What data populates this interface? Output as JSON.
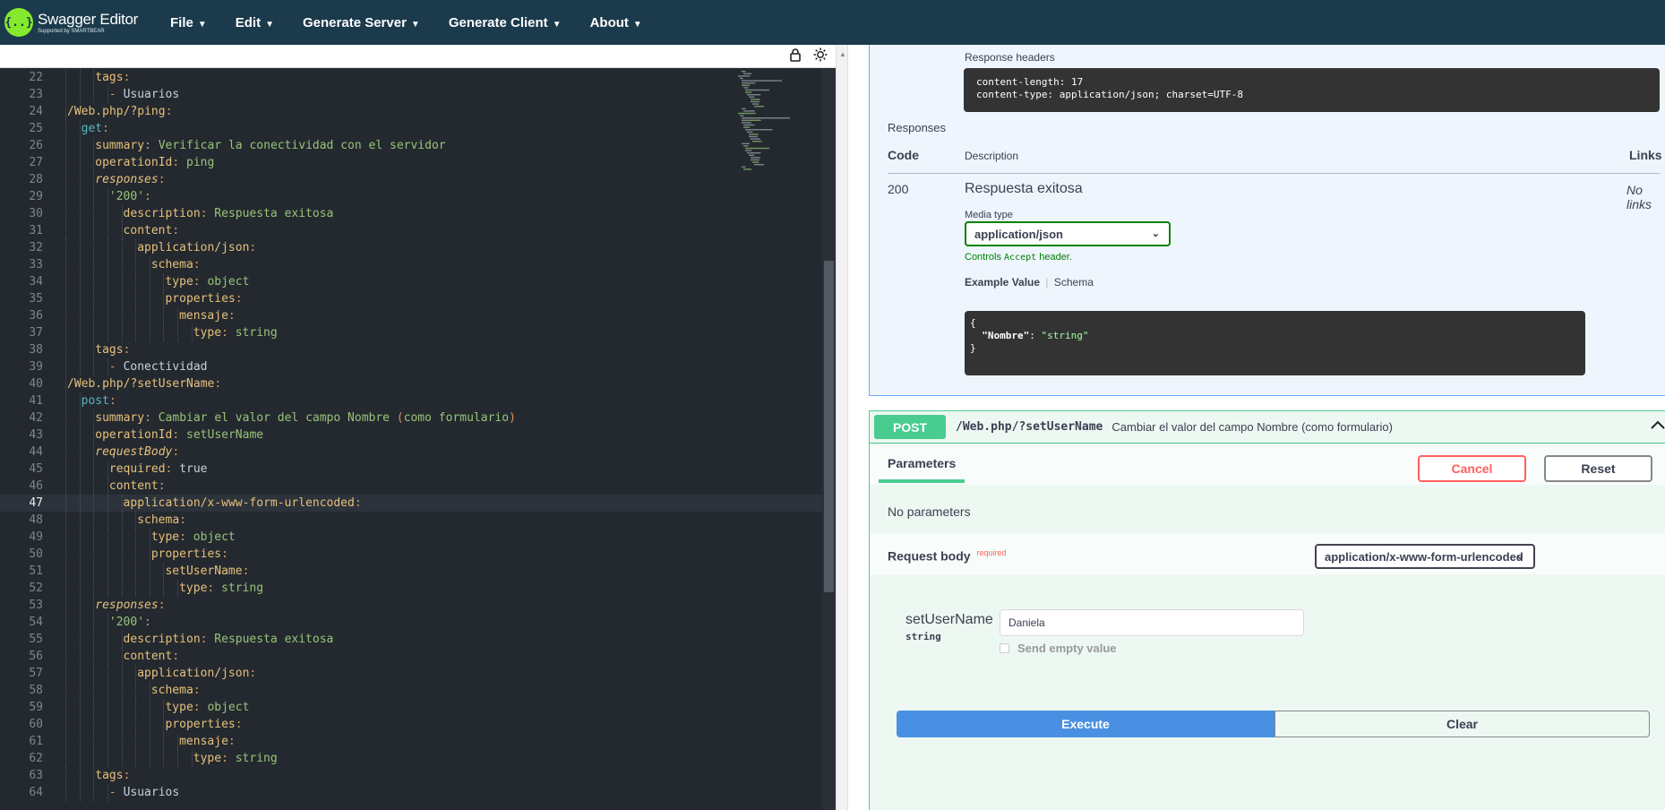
{
  "app": {
    "logo_text": "Swagger Editor",
    "logo_subtext": "Supported by SMARTBEAR",
    "logo_glyph": "{..}"
  },
  "menu": [
    {
      "label": "File"
    },
    {
      "label": "Edit"
    },
    {
      "label": "Generate Server"
    },
    {
      "label": "Generate Client"
    },
    {
      "label": "About"
    }
  ],
  "editor": {
    "active_line": 47,
    "lines": [
      {
        "n": 22,
        "indent": 3,
        "parts": [
          [
            "k-key",
            "tags"
          ],
          [
            "k-colon",
            ":"
          ]
        ]
      },
      {
        "n": 23,
        "indent": 4,
        "parts": [
          [
            "k-colon",
            "- "
          ],
          [
            "k-val",
            "Usuarios"
          ]
        ]
      },
      {
        "n": 24,
        "indent": 1,
        "parts": [
          [
            "k-path",
            "/Web.php/?ping"
          ],
          [
            "k-colon",
            ":"
          ]
        ]
      },
      {
        "n": 25,
        "indent": 2,
        "parts": [
          [
            "k-method",
            "get"
          ],
          [
            "k-colon",
            ":"
          ]
        ]
      },
      {
        "n": 26,
        "indent": 3,
        "parts": [
          [
            "k-key",
            "summary"
          ],
          [
            "k-colon",
            ": "
          ],
          [
            "k-str",
            "Verificar la conectividad con el servidor"
          ]
        ]
      },
      {
        "n": 27,
        "indent": 3,
        "parts": [
          [
            "k-key",
            "operationId"
          ],
          [
            "k-colon",
            ": "
          ],
          [
            "k-str",
            "ping"
          ]
        ]
      },
      {
        "n": 28,
        "indent": 3,
        "parts": [
          [
            "k-key k-it",
            "responses"
          ],
          [
            "k-colon",
            ":"
          ]
        ]
      },
      {
        "n": 29,
        "indent": 4,
        "parts": [
          [
            "k-str",
            "'200'"
          ],
          [
            "k-colon",
            ":"
          ]
        ]
      },
      {
        "n": 30,
        "indent": 5,
        "parts": [
          [
            "k-key",
            "description"
          ],
          [
            "k-colon",
            ": "
          ],
          [
            "k-str",
            "Respuesta exitosa"
          ]
        ]
      },
      {
        "n": 31,
        "indent": 5,
        "parts": [
          [
            "k-key",
            "content"
          ],
          [
            "k-colon",
            ":"
          ]
        ]
      },
      {
        "n": 32,
        "indent": 6,
        "parts": [
          [
            "k-key",
            "application/json"
          ],
          [
            "k-colon",
            ":"
          ]
        ]
      },
      {
        "n": 33,
        "indent": 7,
        "parts": [
          [
            "k-key",
            "schema"
          ],
          [
            "k-colon",
            ":"
          ]
        ]
      },
      {
        "n": 34,
        "indent": 8,
        "parts": [
          [
            "k-key",
            "type"
          ],
          [
            "k-colon",
            ": "
          ],
          [
            "k-str",
            "object"
          ]
        ]
      },
      {
        "n": 35,
        "indent": 8,
        "parts": [
          [
            "k-key",
            "properties"
          ],
          [
            "k-colon",
            ":"
          ]
        ]
      },
      {
        "n": 36,
        "indent": 9,
        "parts": [
          [
            "k-key",
            "mensaje"
          ],
          [
            "k-colon",
            ":"
          ]
        ]
      },
      {
        "n": 37,
        "indent": 10,
        "parts": [
          [
            "k-key",
            "type"
          ],
          [
            "k-colon",
            ": "
          ],
          [
            "k-str",
            "string"
          ]
        ]
      },
      {
        "n": 38,
        "indent": 3,
        "parts": [
          [
            "k-key",
            "tags"
          ],
          [
            "k-colon",
            ":"
          ]
        ]
      },
      {
        "n": 39,
        "indent": 4,
        "parts": [
          [
            "k-colon",
            "- "
          ],
          [
            "k-val",
            "Conectividad"
          ]
        ]
      },
      {
        "n": 40,
        "indent": 1,
        "parts": [
          [
            "k-path",
            "/Web.php/?setUserName"
          ],
          [
            "k-colon",
            ":"
          ]
        ]
      },
      {
        "n": 41,
        "indent": 2,
        "parts": [
          [
            "k-method",
            "post"
          ],
          [
            "k-colon",
            ":"
          ]
        ]
      },
      {
        "n": 42,
        "indent": 3,
        "parts": [
          [
            "k-key",
            "summary"
          ],
          [
            "k-colon",
            ": "
          ],
          [
            "k-str",
            "Cambiar el valor del campo Nombre "
          ],
          [
            "k-colon",
            "("
          ],
          [
            "k-str",
            "como formulario"
          ],
          [
            "k-colon",
            ")"
          ]
        ]
      },
      {
        "n": 43,
        "indent": 3,
        "parts": [
          [
            "k-key",
            "operationId"
          ],
          [
            "k-colon",
            ": "
          ],
          [
            "k-str",
            "setUserName"
          ]
        ]
      },
      {
        "n": 44,
        "indent": 3,
        "parts": [
          [
            "k-key k-it",
            "requestBody"
          ],
          [
            "k-colon",
            ":"
          ]
        ]
      },
      {
        "n": 45,
        "indent": 4,
        "parts": [
          [
            "k-key",
            "required"
          ],
          [
            "k-colon",
            ": "
          ],
          [
            "k-val",
            "true"
          ]
        ]
      },
      {
        "n": 46,
        "indent": 4,
        "parts": [
          [
            "k-key",
            "content"
          ],
          [
            "k-colon",
            ":"
          ]
        ]
      },
      {
        "n": 47,
        "indent": 5,
        "parts": [
          [
            "k-key",
            "application/x-www-form-urlencoded"
          ],
          [
            "k-colon",
            ":"
          ]
        ]
      },
      {
        "n": 48,
        "indent": 6,
        "parts": [
          [
            "k-key",
            "schema"
          ],
          [
            "k-colon",
            ":"
          ]
        ]
      },
      {
        "n": 49,
        "indent": 7,
        "parts": [
          [
            "k-key",
            "type"
          ],
          [
            "k-colon",
            ": "
          ],
          [
            "k-str",
            "object"
          ]
        ]
      },
      {
        "n": 50,
        "indent": 7,
        "parts": [
          [
            "k-key",
            "properties"
          ],
          [
            "k-colon",
            ":"
          ]
        ]
      },
      {
        "n": 51,
        "indent": 8,
        "parts": [
          [
            "k-key",
            "setUserName"
          ],
          [
            "k-colon",
            ":"
          ]
        ]
      },
      {
        "n": 52,
        "indent": 9,
        "parts": [
          [
            "k-key",
            "type"
          ],
          [
            "k-colon",
            ": "
          ],
          [
            "k-str",
            "string"
          ]
        ]
      },
      {
        "n": 53,
        "indent": 3,
        "parts": [
          [
            "k-key k-it",
            "responses"
          ],
          [
            "k-colon",
            ":"
          ]
        ]
      },
      {
        "n": 54,
        "indent": 4,
        "parts": [
          [
            "k-str",
            "'200'"
          ],
          [
            "k-colon",
            ":"
          ]
        ]
      },
      {
        "n": 55,
        "indent": 5,
        "parts": [
          [
            "k-key",
            "description"
          ],
          [
            "k-colon",
            ": "
          ],
          [
            "k-str",
            "Respuesta exitosa"
          ]
        ]
      },
      {
        "n": 56,
        "indent": 5,
        "parts": [
          [
            "k-key",
            "content"
          ],
          [
            "k-colon",
            ":"
          ]
        ]
      },
      {
        "n": 57,
        "indent": 6,
        "parts": [
          [
            "k-key",
            "application/json"
          ],
          [
            "k-colon",
            ":"
          ]
        ]
      },
      {
        "n": 58,
        "indent": 7,
        "parts": [
          [
            "k-key",
            "schema"
          ],
          [
            "k-colon",
            ":"
          ]
        ]
      },
      {
        "n": 59,
        "indent": 8,
        "parts": [
          [
            "k-key",
            "type"
          ],
          [
            "k-colon",
            ": "
          ],
          [
            "k-str",
            "object"
          ]
        ]
      },
      {
        "n": 60,
        "indent": 8,
        "parts": [
          [
            "k-key",
            "properties"
          ],
          [
            "k-colon",
            ":"
          ]
        ]
      },
      {
        "n": 61,
        "indent": 9,
        "parts": [
          [
            "k-key",
            "mensaje"
          ],
          [
            "k-colon",
            ":"
          ]
        ]
      },
      {
        "n": 62,
        "indent": 10,
        "parts": [
          [
            "k-key",
            "type"
          ],
          [
            "k-colon",
            ": "
          ],
          [
            "k-str",
            "string"
          ]
        ]
      },
      {
        "n": 63,
        "indent": 3,
        "parts": [
          [
            "k-key",
            "tags"
          ],
          [
            "k-colon",
            ":"
          ]
        ]
      },
      {
        "n": 64,
        "indent": 4,
        "parts": [
          [
            "k-colon",
            "- "
          ],
          [
            "k-val",
            "Usuarios"
          ]
        ]
      }
    ]
  },
  "get_response": {
    "headers_label": "Response headers",
    "headers_lines": [
      "content-length: 17",
      "content-type: application/json; charset=UTF-8"
    ],
    "responses_label": "Responses",
    "col_code": "Code",
    "col_description": "Description",
    "col_links": "Links",
    "code": "200",
    "description": "Respuesta exitosa",
    "links": "No links",
    "media_type_label": "Media type",
    "media_type_value": "application/json",
    "controls_text_prefix": "Controls ",
    "controls_text_code": "Accept",
    "controls_text_suffix": " header.",
    "example_value_tab": "Example Value",
    "schema_tab": "Schema",
    "example_lines": [
      "{",
      "  \"Nombre\": \"string\"",
      "}"
    ]
  },
  "post_op": {
    "method": "POST",
    "path": "/Web.php/?setUserName",
    "summary": "Cambiar el valor del campo Nombre (como formulario)",
    "parameters_tab": "Parameters",
    "cancel_label": "Cancel",
    "reset_label": "Reset",
    "no_parameters": "No parameters",
    "request_body_label": "Request body",
    "required_label": "required",
    "content_type_value": "application/x-www-form-urlencoded",
    "field_name": "setUserName",
    "field_type": "string",
    "field_value": "Daniela",
    "send_empty_label": "Send empty value",
    "execute_label": "Execute",
    "clear_label": "Clear"
  },
  "colors": {
    "post_green": "#49cc90",
    "get_blue": "#61affe",
    "execute_blue": "#4990e2",
    "cancel_red": "#ff6060"
  }
}
